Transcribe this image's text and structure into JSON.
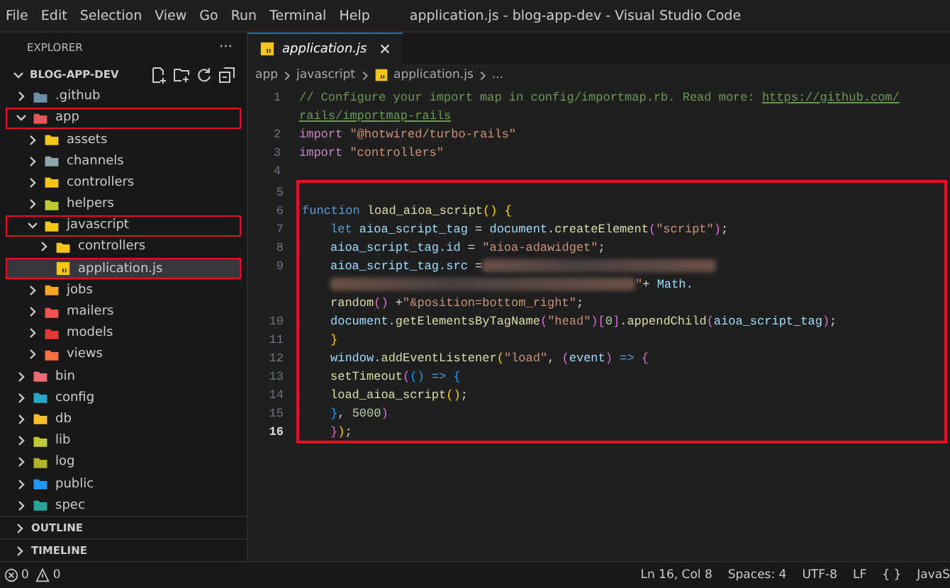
{
  "menu": [
    "File",
    "Edit",
    "Selection",
    "View",
    "Go",
    "Run",
    "Terminal",
    "Help"
  ],
  "window": {
    "title": "application.js - blog-app-dev - Visual Studio Code"
  },
  "sidebar": {
    "title": "EXPLORER",
    "more": "···",
    "project": "BLOG-APP-DEV",
    "tree": [
      {
        "label": ".github",
        "kind": "folder",
        "color": "#6d8fa8",
        "expanded": false,
        "selected": false,
        "highlighted": false
      },
      {
        "label": "app",
        "kind": "folder",
        "color": "#e05a5a",
        "expanded": true,
        "selected": false,
        "highlighted": true,
        "children": [
          {
            "label": "assets",
            "kind": "folder",
            "color": "#f5c518",
            "expanded": false,
            "selected": false,
            "highlighted": false
          },
          {
            "label": "channels",
            "kind": "folder",
            "color": "#90a4ae",
            "expanded": false,
            "selected": false,
            "highlighted": false
          },
          {
            "label": "controllers",
            "kind": "folder",
            "color": "#f5c518",
            "expanded": false,
            "selected": false,
            "highlighted": false
          },
          {
            "label": "helpers",
            "kind": "folder",
            "color": "#c0ca33",
            "expanded": false,
            "selected": false,
            "highlighted": false
          },
          {
            "label": "javascript",
            "kind": "folder",
            "color": "#f5c518",
            "expanded": true,
            "selected": false,
            "highlighted": true,
            "children": [
              {
                "label": "controllers",
                "kind": "folder",
                "color": "#f5c518",
                "expanded": false,
                "selected": false,
                "highlighted": false
              },
              {
                "label": "application.js",
                "kind": "file",
                "color": "#f5c518",
                "selected": true,
                "highlighted": true
              }
            ]
          },
          {
            "label": "jobs",
            "kind": "folder",
            "color": "#f5a623",
            "expanded": false,
            "selected": false,
            "highlighted": false
          },
          {
            "label": "mailers",
            "kind": "folder",
            "color": "#ef5350",
            "expanded": false,
            "selected": false,
            "highlighted": false
          },
          {
            "label": "models",
            "kind": "folder",
            "color": "#e53935",
            "expanded": false,
            "selected": false,
            "highlighted": false
          },
          {
            "label": "views",
            "kind": "folder",
            "color": "#ff7043",
            "expanded": false,
            "selected": false,
            "highlighted": false
          }
        ]
      },
      {
        "label": "bin",
        "kind": "folder",
        "color": "#ec6a74",
        "expanded": false,
        "selected": false,
        "highlighted": false
      },
      {
        "label": "config",
        "kind": "folder",
        "color": "#26a9c6",
        "expanded": false,
        "selected": false,
        "highlighted": false
      },
      {
        "label": "db",
        "kind": "folder",
        "color": "#fbc02d",
        "expanded": false,
        "selected": false,
        "highlighted": false
      },
      {
        "label": "lib",
        "kind": "folder",
        "color": "#c0ca33",
        "expanded": false,
        "selected": false,
        "highlighted": false
      },
      {
        "label": "log",
        "kind": "folder",
        "color": "#afb42b",
        "expanded": false,
        "selected": false,
        "highlighted": false
      },
      {
        "label": "public",
        "kind": "folder",
        "color": "#2196f3",
        "expanded": false,
        "selected": false,
        "highlighted": false
      },
      {
        "label": "spec",
        "kind": "folder",
        "color": "#26a69a",
        "expanded": false,
        "selected": false,
        "highlighted": false
      }
    ],
    "sections": [
      {
        "label": "OUTLINE",
        "expanded": false
      },
      {
        "label": "TIMELINE",
        "expanded": false
      }
    ]
  },
  "tabs": [
    {
      "label": "application.js",
      "selected": true
    }
  ],
  "breadcrumbs": [
    "app",
    "javascript",
    "application.js",
    "..."
  ],
  "code": {
    "groups": [
      {
        "highlighted": false,
        "lines": [
          {
            "number": "1",
            "current": false,
            "rows": [
              {
                "indent": false,
                "tokens": [
                  {
                    "text": "// Configure your import map in config/importmap.rb. Read more:",
                    "kind": "comment",
                    "spaced": false
                  },
                  {
                    "text": "https://github.com/",
                    "kind": "link",
                    "spaced": true
                  }
                ]
              },
              {
                "indent": false,
                "tokens": [
                  {
                    "text": "rails/importmap-rails",
                    "kind": "link",
                    "spaced": false
                  }
                ]
              }
            ]
          },
          {
            "number": "2",
            "current": false,
            "rows": [
              {
                "indent": false,
                "tokens": [
                  {
                    "text": "import",
                    "kind": "import",
                    "spaced": false
                  },
                  {
                    "text": "\"@hotwired/turbo-rails\"",
                    "kind": "string",
                    "spaced": true
                  }
                ]
              }
            ]
          },
          {
            "number": "3",
            "current": false,
            "rows": [
              {
                "indent": false,
                "tokens": [
                  {
                    "text": "import",
                    "kind": "import",
                    "spaced": false
                  },
                  {
                    "text": "\"controllers\"",
                    "kind": "string",
                    "spaced": true
                  }
                ]
              }
            ]
          },
          {
            "number": "4",
            "current": false
          }
        ]
      },
      {
        "highlighted": true,
        "lines": [
          {
            "number": "5",
            "current": false
          },
          {
            "number": "6",
            "current": false,
            "rows": [
              {
                "indent": false,
                "tokens": [
                  {
                    "text": "function",
                    "kind": "keyword",
                    "spaced": false
                  },
                  {
                    "text": "load_aioa_script",
                    "kind": "func",
                    "spaced": true
                  },
                  {
                    "text": "()",
                    "kind": "bracket",
                    "spaced": false
                  },
                  {
                    "text": "{",
                    "kind": "bracket",
                    "spaced": true
                  }
                ]
              }
            ]
          },
          {
            "number": "7",
            "current": false,
            "rows": [
              {
                "indent": true,
                "tokens": [
                  {
                    "text": "let",
                    "kind": "keyword",
                    "spaced": false
                  },
                  {
                    "text": "aioa_script_tag",
                    "kind": "var",
                    "spaced": true
                  },
                  {
                    "text": "=",
                    "kind": "plain",
                    "spaced": true
                  },
                  {
                    "text": "document",
                    "kind": "var",
                    "spaced": true
                  },
                  {
                    "text": ".",
                    "kind": "plain",
                    "spaced": false
                  },
                  {
                    "text": "createElement",
                    "kind": "func",
                    "spaced": false
                  },
                  {
                    "text": "(",
                    "kind": "bracket2",
                    "spaced": false
                  },
                  {
                    "text": "\"script\"",
                    "kind": "string",
                    "spaced": false
                  },
                  {
                    "text": ")",
                    "kind": "bracket2",
                    "spaced": false
                  },
                  {
                    "text": ";",
                    "kind": "plain",
                    "spaced": false
                  }
                ]
              }
            ]
          },
          {
            "number": "8",
            "current": false,
            "rows": [
              {
                "indent": true,
                "tokens": [
                  {
                    "text": "aioa_script_tag.id",
                    "kind": "var",
                    "spaced": false
                  },
                  {
                    "text": "=",
                    "kind": "plain",
                    "spaced": true
                  },
                  {
                    "text": "\"aioa-adawidget\"",
                    "kind": "string",
                    "spaced": true
                  },
                  {
                    "text": ";",
                    "kind": "plain",
                    "spaced": false
                  }
                ]
              }
            ]
          },
          {
            "number": "9",
            "current": false,
            "rows": [
              {
                "indent": true,
                "tokens": [
                  {
                    "text": "aioa_script_tag.src",
                    "kind": "var",
                    "spaced": false
                  },
                  {
                    "text": "=",
                    "kind": "plain",
                    "spaced": true
                  },
                  {
                    "kind": "blur",
                    "spaced": true
                  }
                ]
              },
              {
                "indent": true,
                "tokens": [
                  {
                    "kind": "blur-wide",
                    "spaced": false
                  },
                  {
                    "text": "\"",
                    "kind": "string",
                    "spaced": false
                  },
                  {
                    "text": "+",
                    "kind": "plain",
                    "spaced": false
                  },
                  {
                    "text": "Math.",
                    "kind": "var",
                    "spaced": true
                  }
                ]
              },
              {
                "indent": true,
                "tokens": [
                  {
                    "text": "random",
                    "kind": "func",
                    "spaced": false
                  },
                  {
                    "text": "()",
                    "kind": "bracket2",
                    "spaced": false
                  },
                  {
                    "text": "+",
                    "kind": "plain",
                    "spaced": true
                  },
                  {
                    "text": "\"&position=bottom_right\"",
                    "kind": "string",
                    "spaced": false
                  },
                  {
                    "text": ";",
                    "kind": "plain",
                    "spaced": false
                  }
                ]
              }
            ]
          },
          {
            "number": "10",
            "current": false,
            "rows": [
              {
                "indent": true,
                "tokens": [
                  {
                    "text": "document.",
                    "kind": "var",
                    "spaced": false
                  },
                  {
                    "text": "getElementsByTagName",
                    "kind": "func",
                    "spaced": false
                  },
                  {
                    "text": "(",
                    "kind": "bracket2",
                    "spaced": false
                  },
                  {
                    "text": "\"head\"",
                    "kind": "string",
                    "spaced": false
                  },
                  {
                    "text": ")[",
                    "kind": "bracket2",
                    "spaced": false
                  },
                  {
                    "text": "0",
                    "kind": "number",
                    "spaced": false
                  },
                  {
                    "text": "]",
                    "kind": "bracket2",
                    "spaced": false
                  },
                  {
                    "text": ".",
                    "kind": "plain",
                    "spaced": false
                  },
                  {
                    "text": "appendChild",
                    "kind": "func",
                    "spaced": false
                  },
                  {
                    "text": "(",
                    "kind": "bracket2",
                    "spaced": false
                  },
                  {
                    "text": "aioa_script_tag",
                    "kind": "var",
                    "spaced": false
                  },
                  {
                    "text": ")",
                    "kind": "bracket2",
                    "spaced": false
                  },
                  {
                    "text": ";",
                    "kind": "plain",
                    "spaced": false
                  }
                ]
              }
            ]
          },
          {
            "number": "11",
            "current": false,
            "rows": [
              {
                "indent": true,
                "tokens": [
                  {
                    "text": "}",
                    "kind": "bracket",
                    "spaced": false
                  }
                ]
              }
            ]
          },
          {
            "number": "12",
            "current": false,
            "rows": [
              {
                "indent": true,
                "tokens": [
                  {
                    "text": "window.",
                    "kind": "var",
                    "spaced": false
                  },
                  {
                    "text": "addEventListener",
                    "kind": "func",
                    "spaced": false
                  },
                  {
                    "text": "(",
                    "kind": "bracket",
                    "spaced": false
                  },
                  {
                    "text": "\"load\"",
                    "kind": "string",
                    "spaced": false
                  },
                  {
                    "text": ",",
                    "kind": "plain",
                    "spaced": false
                  },
                  {
                    "text": "(",
                    "kind": "bracket2",
                    "spaced": true
                  },
                  {
                    "text": "event",
                    "kind": "var",
                    "spaced": false
                  },
                  {
                    "text": ")",
                    "kind": "bracket2",
                    "spaced": false
                  },
                  {
                    "text": "=>",
                    "kind": "keyword",
                    "spaced": true
                  },
                  {
                    "text": "{",
                    "kind": "bracket2",
                    "spaced": true
                  }
                ]
              }
            ]
          },
          {
            "number": "13",
            "current": false,
            "rows": [
              {
                "indent": true,
                "tokens": [
                  {
                    "text": "setTimeout",
                    "kind": "func",
                    "spaced": false
                  },
                  {
                    "text": "(",
                    "kind": "bracket2",
                    "spaced": false
                  },
                  {
                    "text": "()",
                    "kind": "bracket3",
                    "spaced": false
                  },
                  {
                    "text": "=>",
                    "kind": "keyword",
                    "spaced": true
                  },
                  {
                    "text": "{",
                    "kind": "bracket3",
                    "spaced": true
                  }
                ]
              }
            ]
          },
          {
            "number": "14",
            "current": false,
            "rows": [
              {
                "indent": true,
                "tokens": [
                  {
                    "text": "load_aioa_script",
                    "kind": "func",
                    "spaced": false
                  },
                  {
                    "text": "()",
                    "kind": "bracket",
                    "spaced": false
                  },
                  {
                    "text": ";",
                    "kind": "plain",
                    "spaced": false
                  }
                ]
              }
            ]
          },
          {
            "number": "15",
            "current": false,
            "rows": [
              {
                "indent": true,
                "tokens": [
                  {
                    "text": "}",
                    "kind": "bracket3",
                    "spaced": false
                  },
                  {
                    "text": ",",
                    "kind": "plain",
                    "spaced": false
                  },
                  {
                    "text": "5000",
                    "kind": "number",
                    "spaced": true
                  },
                  {
                    "text": ")",
                    "kind": "bracket2",
                    "spaced": false
                  }
                ]
              }
            ]
          },
          {
            "number": "16",
            "current": true,
            "rows": [
              {
                "indent": true,
                "tokens": [
                  {
                    "text": "}",
                    "kind": "bracket2",
                    "spaced": false
                  },
                  {
                    "text": ")",
                    "kind": "bracket",
                    "spaced": false
                  },
                  {
                    "text": ";",
                    "kind": "plain",
                    "spaced": false
                  }
                ]
              }
            ]
          }
        ]
      }
    ]
  },
  "status_bar": {
    "errors": "0",
    "warnings": "0",
    "items": [
      "Ln 16, Col 8",
      "Spaces: 4",
      "UTF-8",
      "LF",
      "{ }",
      "JavaS"
    ]
  }
}
